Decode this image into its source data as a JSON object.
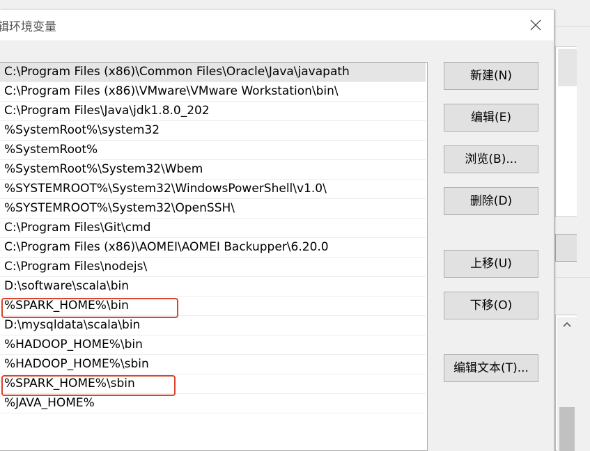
{
  "dialog": {
    "title": "辑环境变量"
  },
  "path_list": {
    "items": [
      "C:\\Program Files (x86)\\Common Files\\Oracle\\Java\\javapath",
      "C:\\Program Files (x86)\\VMware\\VMware Workstation\\bin\\",
      "C:\\Program Files\\Java\\jdk1.8.0_202",
      "%SystemRoot%\\system32",
      "%SystemRoot%",
      "%SystemRoot%\\System32\\Wbem",
      "%SYSTEMROOT%\\System32\\WindowsPowerShell\\v1.0\\",
      "%SYSTEMROOT%\\System32\\OpenSSH\\",
      "C:\\Program Files\\Git\\cmd",
      "C:\\Program Files (x86)\\AOMEI\\AOMEI Backupper\\6.20.0",
      "C:\\Program Files\\nodejs\\",
      "D:\\software\\scala\\bin",
      "%SPARK_HOME%\\bin",
      "D:\\mysqldata\\scala\\bin",
      "%HADOOP_HOME%\\bin",
      "%HADOOP_HOME%\\sbin",
      "%SPARK_HOME%\\sbin",
      "%JAVA_HOME%"
    ],
    "selected_item": "C:\\Program Files (x86)\\Common Files\\Oracle\\Java\\javapath",
    "highlighted_items": [
      "%SPARK_HOME%\\bin",
      "%SPARK_HOME%\\sbin"
    ],
    "highlight_color": "#d9442c"
  },
  "buttons": {
    "new": "新建(N)",
    "edit": "编辑(E)",
    "browse": "浏览(B)...",
    "delete": "删除(D)",
    "move_up": "上移(U)",
    "move_down": "下移(O)",
    "edit_text": "编辑文本(T)..."
  },
  "icons": {
    "close": "close-icon",
    "scroll_up": "chevron-up-icon"
  }
}
